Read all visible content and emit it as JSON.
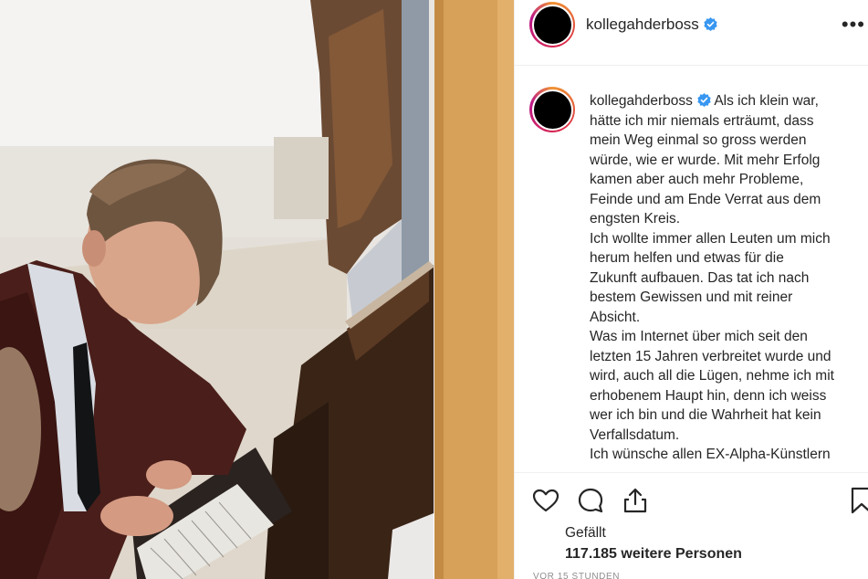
{
  "post": {
    "username": "kollegahderboss",
    "verified": true,
    "more_icon": "more-horizontal-icon",
    "caption_lines": [
      "Als ich klein war,",
      "hätte ich mir niemals erträumt, dass",
      "mein Weg einmal so gross werden",
      "würde, wie er wurde. Mit mehr Erfolg",
      "kamen aber auch mehr Probleme,",
      "Feinde und am Ende Verrat aus dem",
      "engsten Kreis.",
      "Ich wollte immer allen Leuten um mich",
      "herum helfen und etwas für die",
      "Zukunft aufbauen. Das tat ich nach",
      "bestem Gewissen und mit reiner",
      "Absicht.",
      "Was im Internet über mich seit den",
      "letzten 15 Jahren verbreitet wurde und",
      "wird, auch all die Lügen, nehme ich mit",
      "erhobenem Haupt hin, denn ich weiss",
      "wer ich bin und die Wahrheit hat kein",
      "Verfallsdatum.",
      "Ich wünsche allen EX-Alpha-Künstlern"
    ],
    "likes_label": "Gefällt",
    "likes_count": "117.185",
    "likes_suffix": "weitere Personen",
    "timestamp": "VOR 15 STUNDEN"
  },
  "icons": {
    "like": "heart-icon",
    "comment": "comment-icon",
    "share": "share-icon",
    "save": "bookmark-icon",
    "verified": "verified-badge-icon"
  },
  "colors": {
    "verified_blue": "#3897f0",
    "text": "#262626",
    "muted": "#8e8e8e",
    "border": "#efefef"
  }
}
